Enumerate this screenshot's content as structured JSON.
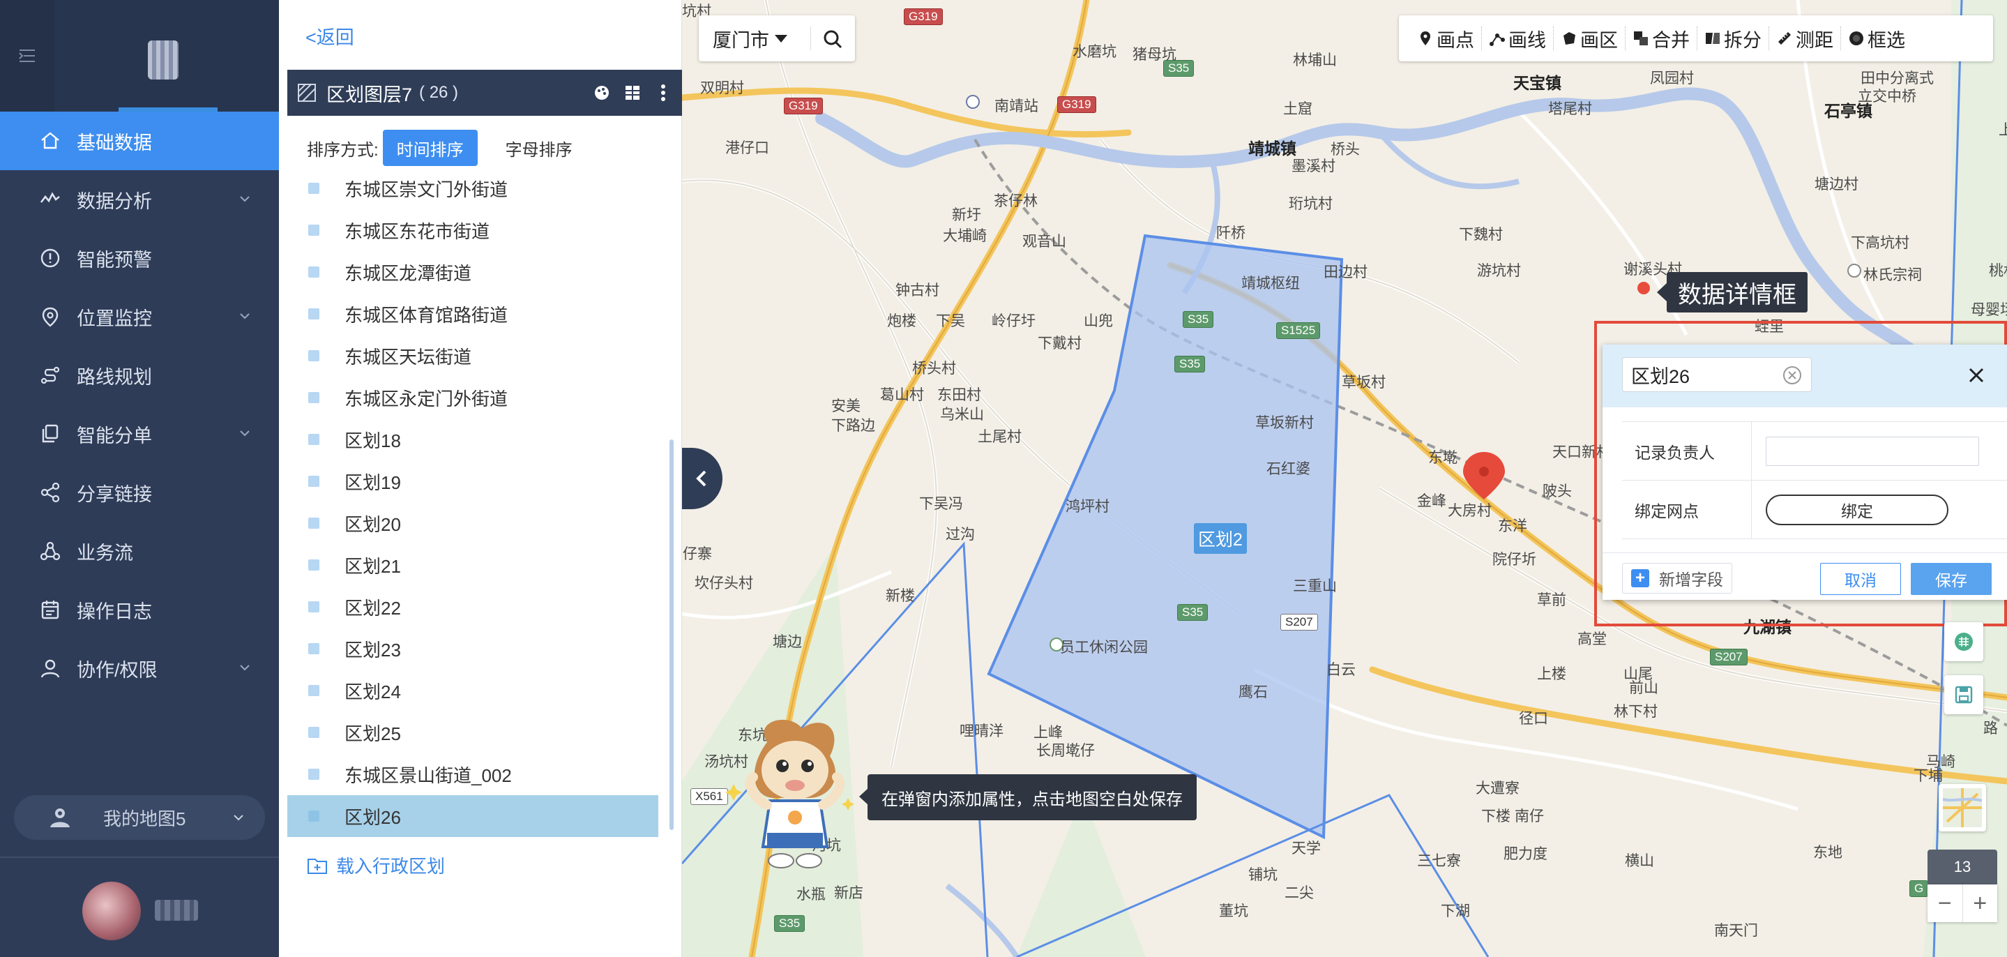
{
  "sidebar": {
    "menu": [
      {
        "label": "基础数据",
        "icon": "home-icon",
        "active": true,
        "expandable": false
      },
      {
        "label": "数据分析",
        "icon": "analytics-icon",
        "active": false,
        "expandable": true
      },
      {
        "label": "智能预警",
        "icon": "alert-icon",
        "active": false,
        "expandable": false
      },
      {
        "label": "位置监控",
        "icon": "location-icon",
        "active": false,
        "expandable": true
      },
      {
        "label": "路线规划",
        "icon": "route-icon",
        "active": false,
        "expandable": false
      },
      {
        "label": "智能分单",
        "icon": "copy-icon",
        "active": false,
        "expandable": true
      },
      {
        "label": "分享链接",
        "icon": "share-icon",
        "active": false,
        "expandable": false
      },
      {
        "label": "业务流",
        "icon": "workflow-icon",
        "active": false,
        "expandable": false
      },
      {
        "label": "操作日志",
        "icon": "calendar-icon",
        "active": false,
        "expandable": false
      },
      {
        "label": "协作/权限",
        "icon": "user-icon",
        "active": false,
        "expandable": true
      }
    ],
    "mymap": "我的地图5"
  },
  "panel": {
    "back": "<返回",
    "layer_title": "区划图层7",
    "layer_count": "( 26 )",
    "sort_label": "排序方式:",
    "sort_time": "时间排序",
    "sort_alpha": "字母排序",
    "items": [
      "东城区崇文门外街道",
      "东城区东花市街道",
      "东城区龙潭街道",
      "东城区体育馆路街道",
      "东城区天坛街道",
      "东城区永定门外街道",
      "区划18",
      "区划19",
      "区划20",
      "区划21",
      "区划22",
      "区划23",
      "区划24",
      "区划25",
      "东城区景山街道_002",
      "区划26"
    ],
    "selected_index": 15,
    "load": "载入行政区划"
  },
  "map": {
    "city": "厦门市",
    "tools": [
      {
        "label": "画点",
        "icon": "pin-icon"
      },
      {
        "label": "画线",
        "icon": "polyline-icon"
      },
      {
        "label": "画区",
        "icon": "polygon-icon"
      },
      {
        "label": "合并",
        "icon": "merge-icon"
      },
      {
        "label": "拆分",
        "icon": "split-icon"
      },
      {
        "label": "测距",
        "icon": "ruler-icon"
      },
      {
        "label": "框选",
        "icon": "lasso-icon"
      }
    ],
    "detail_tag": "数据详情框",
    "zone_label": "区划2",
    "zoom": "13",
    "tip": "在弹窗内添加属性，点击地图空白处保存",
    "places": [
      {
        "t": "水磨坑"
      },
      {
        "t": "猪母坑"
      },
      {
        "t": "林埔山"
      },
      {
        "t": "天宝镇",
        "big": true
      },
      {
        "t": "凤园村"
      },
      {
        "t": "田中分离式"
      },
      {
        "t": "立交中桥"
      },
      {
        "t": "双明村"
      },
      {
        "t": "南靖站"
      },
      {
        "t": "土窟"
      },
      {
        "t": "塔尾村"
      },
      {
        "t": "石亭镇",
        "big": true
      },
      {
        "t": "上巷通道"
      },
      {
        "t": "港仔口"
      },
      {
        "t": "靖城镇",
        "big": true
      },
      {
        "t": "桥头"
      },
      {
        "t": "墨溪村"
      },
      {
        "t": "塘边村"
      },
      {
        "t": "茶仔林"
      },
      {
        "t": "珩坑村"
      },
      {
        "t": "新圩"
      },
      {
        "t": "大埔崎"
      },
      {
        "t": "阡桥"
      },
      {
        "t": "下魏村"
      },
      {
        "t": "下高坑村"
      },
      {
        "t": "观音山"
      },
      {
        "t": "游坑村"
      },
      {
        "t": "谢溪头村"
      },
      {
        "t": "林氏宗祠"
      },
      {
        "t": "钟古村"
      },
      {
        "t": "靖城枢纽"
      },
      {
        "t": "田边村"
      },
      {
        "t": "炮楼"
      },
      {
        "t": "下吴"
      },
      {
        "t": "岭仔圩"
      },
      {
        "t": "山兜"
      },
      {
        "t": "下戴村"
      },
      {
        "t": "桥头村"
      },
      {
        "t": "葛山村"
      },
      {
        "t": "东田村"
      },
      {
        "t": "草坂村"
      },
      {
        "t": "安美"
      },
      {
        "t": "下路边"
      },
      {
        "t": "乌米山"
      },
      {
        "t": "土尾村"
      },
      {
        "t": "草坂新村"
      },
      {
        "t": "东墘"
      },
      {
        "t": "天口新村"
      },
      {
        "t": "石红婆"
      },
      {
        "t": "鸿坪村"
      },
      {
        "t": "下吴冯"
      },
      {
        "t": "金峰"
      },
      {
        "t": "大房村"
      },
      {
        "t": "陂头"
      },
      {
        "t": "过沟"
      },
      {
        "t": "东洋"
      },
      {
        "t": "仔寨"
      },
      {
        "t": "院仔圻"
      },
      {
        "t": "坎仔头村"
      },
      {
        "t": "三重山"
      },
      {
        "t": "草前"
      },
      {
        "t": "新楼"
      },
      {
        "t": "塘边"
      },
      {
        "t": "员工休闲公园"
      },
      {
        "t": "高堂"
      },
      {
        "t": "九湖镇",
        "big": true
      },
      {
        "t": "白云"
      },
      {
        "t": "上楼"
      },
      {
        "t": "山尾"
      },
      {
        "t": "鹰石"
      },
      {
        "t": "径口"
      },
      {
        "t": "前山"
      },
      {
        "t": "林下村"
      },
      {
        "t": "哩晴洋"
      },
      {
        "t": "上峰"
      },
      {
        "t": "汤坑村"
      },
      {
        "t": "长周墘仔"
      },
      {
        "t": "东坑"
      },
      {
        "t": "白云"
      },
      {
        "t": "大遭寮"
      },
      {
        "t": "下楼"
      },
      {
        "t": "南仔"
      },
      {
        "t": "下埔"
      },
      {
        "t": "马崎"
      },
      {
        "t": "河坑"
      },
      {
        "t": "天学"
      },
      {
        "t": "肥力度"
      },
      {
        "t": "横山"
      },
      {
        "t": "东地"
      },
      {
        "t": "水瓶"
      },
      {
        "t": "新店"
      },
      {
        "t": "铺坑"
      },
      {
        "t": "二尖"
      },
      {
        "t": "三七寮"
      },
      {
        "t": "下湖"
      },
      {
        "t": "南天门"
      },
      {
        "t": "董坑"
      },
      {
        "t": "蛭里"
      },
      {
        "t": "母婴场游乐场"
      },
      {
        "t": "桃林"
      },
      {
        "t": "路"
      },
      {
        "t": "坑村"
      }
    ],
    "shields": [
      {
        "t": "G319",
        "c": "red"
      },
      {
        "t": "G319",
        "c": "red"
      },
      {
        "t": "G319",
        "c": "red"
      },
      {
        "t": "S35"
      },
      {
        "t": "S35"
      },
      {
        "t": "S35"
      },
      {
        "t": "S1525"
      },
      {
        "t": "S35"
      },
      {
        "t": "S207",
        "c": "plain"
      },
      {
        "t": "S207"
      },
      {
        "t": "X561",
        "c": "plain"
      },
      {
        "t": "S35"
      },
      {
        "t": "S35"
      },
      {
        "t": "G"
      }
    ]
  },
  "popup": {
    "name": "区划26",
    "fields": [
      {
        "label": "记录负责人",
        "type": "input",
        "value": ""
      },
      {
        "label": "绑定网点",
        "type": "button",
        "value": "绑定"
      }
    ],
    "add_field": "新增字段",
    "cancel": "取消",
    "save": "保存"
  },
  "colors": {
    "sidebar": "#2e3c58",
    "accent": "#3d8ef0",
    "selected_row": "#a7d1e9",
    "zone_fill": "#a9c3f0",
    "zone_stroke": "#5b8ee6",
    "highlight_frame": "#e24a3a"
  }
}
